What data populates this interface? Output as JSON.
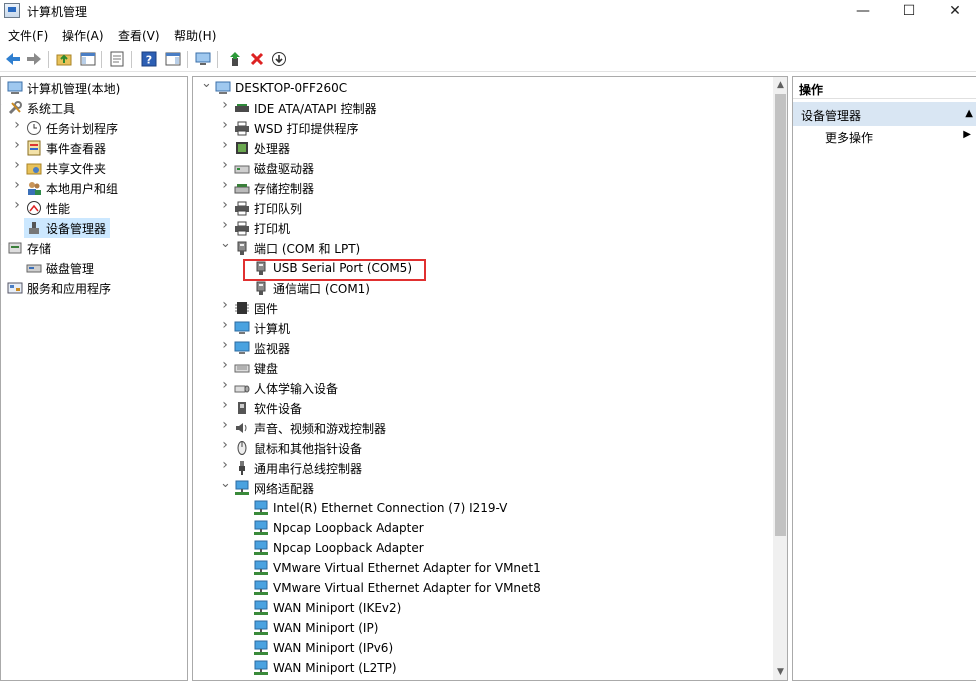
{
  "window": {
    "title": "计算机管理",
    "controls": {
      "minimize": "—",
      "maximize": "☐",
      "close": "✕"
    }
  },
  "menu": [
    "文件(F)",
    "操作(A)",
    "查看(V)",
    "帮助(H)"
  ],
  "left_tree": [
    {
      "label": "计算机管理(本地)",
      "icon": "computer-manage-icon",
      "level": 0,
      "expander": ""
    },
    {
      "label": "系统工具",
      "icon": "tools-icon",
      "level": 0,
      "expander": "open"
    },
    {
      "label": "任务计划程序",
      "icon": "clock-icon",
      "level": 1,
      "expander": "closed"
    },
    {
      "label": "事件查看器",
      "icon": "event-viewer-icon",
      "level": 1,
      "expander": "closed"
    },
    {
      "label": "共享文件夹",
      "icon": "shared-folder-icon",
      "level": 1,
      "expander": "closed"
    },
    {
      "label": "本地用户和组",
      "icon": "users-icon",
      "level": 1,
      "expander": "closed"
    },
    {
      "label": "性能",
      "icon": "performance-icon",
      "level": 1,
      "expander": "closed"
    },
    {
      "label": "设备管理器",
      "icon": "device-manager-icon",
      "level": 1,
      "expander": "",
      "selected": true
    },
    {
      "label": "存储",
      "icon": "storage-icon",
      "level": 0,
      "expander": "open"
    },
    {
      "label": "磁盘管理",
      "icon": "disk-icon",
      "level": 1,
      "expander": ""
    },
    {
      "label": "服务和应用程序",
      "icon": "services-icon",
      "level": 0,
      "expander": "closed"
    }
  ],
  "device_tree": [
    {
      "label": "DESKTOP-0FF260C",
      "icon": "computer-icon",
      "level": 0,
      "expander": "open"
    },
    {
      "label": "IDE ATA/ATAPI 控制器",
      "icon": "ide-controller-icon",
      "level": 1,
      "expander": "closed"
    },
    {
      "label": "WSD 打印提供程序",
      "icon": "printer-icon",
      "level": 1,
      "expander": "closed"
    },
    {
      "label": "处理器",
      "icon": "cpu-icon",
      "level": 1,
      "expander": "closed"
    },
    {
      "label": "磁盘驱动器",
      "icon": "disk-drive-icon",
      "level": 1,
      "expander": "closed"
    },
    {
      "label": "存储控制器",
      "icon": "storage-controller-icon",
      "level": 1,
      "expander": "closed"
    },
    {
      "label": "打印队列",
      "icon": "printer-icon",
      "level": 1,
      "expander": "closed"
    },
    {
      "label": "打印机",
      "icon": "printer-icon",
      "level": 1,
      "expander": "closed"
    },
    {
      "label": "端口 (COM 和 LPT)",
      "icon": "port-icon",
      "level": 1,
      "expander": "open"
    },
    {
      "label": "USB Serial Port (COM5)",
      "icon": "port-icon",
      "level": 2,
      "expander": "",
      "highlighted": true
    },
    {
      "label": "通信端口 (COM1)",
      "icon": "port-icon",
      "level": 2,
      "expander": ""
    },
    {
      "label": "固件",
      "icon": "firmware-icon",
      "level": 1,
      "expander": "closed"
    },
    {
      "label": "计算机",
      "icon": "monitor-icon",
      "level": 1,
      "expander": "closed"
    },
    {
      "label": "监视器",
      "icon": "monitor-icon",
      "level": 1,
      "expander": "closed"
    },
    {
      "label": "键盘",
      "icon": "keyboard-icon",
      "level": 1,
      "expander": "closed"
    },
    {
      "label": "人体学输入设备",
      "icon": "hid-icon",
      "level": 1,
      "expander": "closed"
    },
    {
      "label": "软件设备",
      "icon": "software-device-icon",
      "level": 1,
      "expander": "closed"
    },
    {
      "label": "声音、视频和游戏控制器",
      "icon": "speaker-icon",
      "level": 1,
      "expander": "closed"
    },
    {
      "label": "鼠标和其他指针设备",
      "icon": "mouse-icon",
      "level": 1,
      "expander": "closed"
    },
    {
      "label": "通用串行总线控制器",
      "icon": "usb-icon",
      "level": 1,
      "expander": "closed"
    },
    {
      "label": "网络适配器",
      "icon": "network-icon",
      "level": 1,
      "expander": "open"
    },
    {
      "label": "Intel(R) Ethernet Connection (7) I219-V",
      "icon": "network-icon",
      "level": 2,
      "expander": ""
    },
    {
      "label": "Npcap Loopback Adapter",
      "icon": "network-icon",
      "level": 2,
      "expander": ""
    },
    {
      "label": "Npcap Loopback Adapter",
      "icon": "network-icon",
      "level": 2,
      "expander": ""
    },
    {
      "label": "VMware Virtual Ethernet Adapter for VMnet1",
      "icon": "network-icon",
      "level": 2,
      "expander": ""
    },
    {
      "label": "VMware Virtual Ethernet Adapter for VMnet8",
      "icon": "network-icon",
      "level": 2,
      "expander": ""
    },
    {
      "label": "WAN Miniport (IKEv2)",
      "icon": "network-icon",
      "level": 2,
      "expander": ""
    },
    {
      "label": "WAN Miniport (IP)",
      "icon": "network-icon",
      "level": 2,
      "expander": ""
    },
    {
      "label": "WAN Miniport (IPv6)",
      "icon": "network-icon",
      "level": 2,
      "expander": ""
    },
    {
      "label": "WAN Miniport (L2TP)",
      "icon": "network-icon",
      "level": 2,
      "expander": ""
    }
  ],
  "actions": {
    "header": "操作",
    "section": "设备管理器",
    "more": "更多操作"
  },
  "colors": {
    "selected": "#cce8ff",
    "highlight_border": "#e03030",
    "actions_section": "#d9e6f3"
  }
}
